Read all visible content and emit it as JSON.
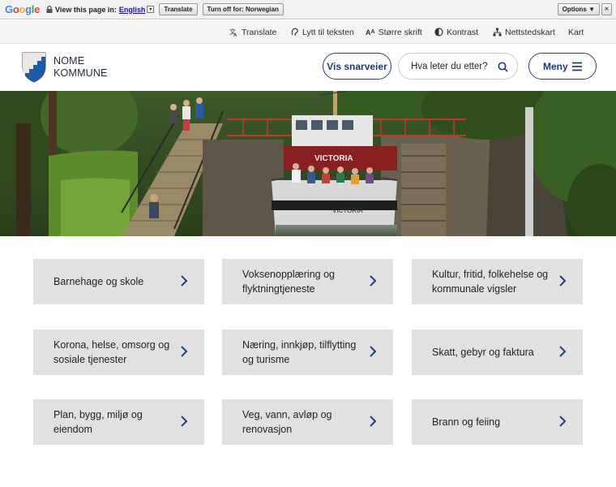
{
  "google_bar": {
    "logo": "Google",
    "prompt": "View this page in:",
    "language": "English",
    "translate_label": "Translate",
    "turn_off_label": "Turn off for: Norwegian",
    "options_label": "Options ▼",
    "close_label": "×"
  },
  "utility": {
    "items": [
      {
        "label": "Translate",
        "icon": "translate-icon"
      },
      {
        "label": "Lytt til teksten",
        "icon": "listen-icon"
      },
      {
        "label": "Større skrift",
        "icon": "text-size-icon"
      },
      {
        "label": "Kontrast",
        "icon": "contrast-icon"
      },
      {
        "label": "Nettstedskart",
        "icon": "sitemap-icon"
      },
      {
        "label": "Kart",
        "icon": ""
      }
    ]
  },
  "header": {
    "logo_line1": "NOME",
    "logo_line2": "KOMMUNE",
    "shortcuts_label": "Vis snarveier",
    "search_placeholder": "Hva leter du etter?",
    "menu_label": "Meny"
  },
  "tiles": [
    {
      "label": "Barnehage og skole"
    },
    {
      "label": "Voksenopplæring og flyktningtjeneste"
    },
    {
      "label": "Kultur, fritid, folkehelse og kommunale vigsler"
    },
    {
      "label": "Korona, helse, omsorg og sosiale tjenester"
    },
    {
      "label": "Næring, innkjøp, tilflytting og turisme"
    },
    {
      "label": "Skatt, gebyr og faktura"
    },
    {
      "label": "Plan, bygg, miljø og eiendom"
    },
    {
      "label": "Veg, vann, avløp og renovasjon"
    },
    {
      "label": "Brann og feiing"
    }
  ],
  "hero": {
    "boat_name": "VICTORIA"
  },
  "colors": {
    "accent": "#23407a",
    "tile_bg": "#e1e1e1",
    "shield_blue": "#1f5aa6"
  }
}
